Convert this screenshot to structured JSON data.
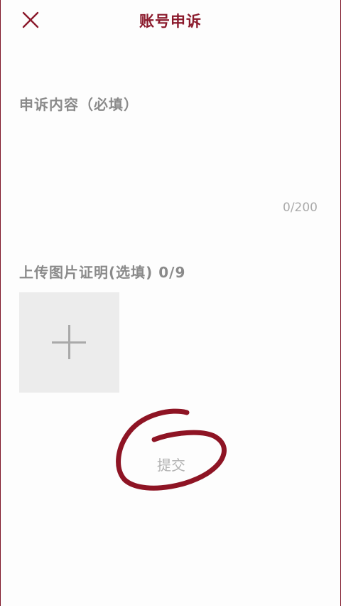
{
  "header": {
    "title": "账号申诉",
    "close_icon": "close-icon"
  },
  "appeal": {
    "label": "申诉内容（必填）",
    "value": "",
    "counter": "0/200"
  },
  "upload": {
    "label": "上传图片证明(选填) 0/9",
    "add_icon": "plus-icon"
  },
  "actions": {
    "submit_label": "提交"
  },
  "colors": {
    "accent": "#8b1a2c",
    "annotation": "#8e1424",
    "label_gray": "#8a8a8a",
    "muted_gray": "#b3b3b3"
  }
}
